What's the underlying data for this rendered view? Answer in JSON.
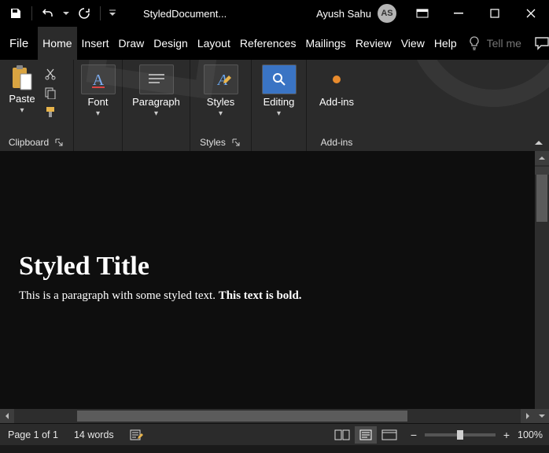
{
  "titlebar": {
    "doc_title": "StyledDocument...",
    "user_name": "Ayush Sahu",
    "user_initials": "AS"
  },
  "menubar": {
    "file": "File",
    "tabs": [
      "Home",
      "Insert",
      "Draw",
      "Design",
      "Layout",
      "References",
      "Mailings",
      "Review",
      "View",
      "Help"
    ],
    "tabs_display": [
      "Home",
      "Insert",
      "Draw",
      "Design",
      "Layout",
      "References",
      "Mailings",
      "Review",
      "View",
      "Help"
    ],
    "tellme_placeholder": "Tell me"
  },
  "ribbon": {
    "clipboard": {
      "paste": "Paste",
      "group": "Clipboard"
    },
    "font": {
      "label": "Font"
    },
    "paragraph": {
      "label": "Paragraph"
    },
    "styles": {
      "label": "Styles",
      "group": "Styles"
    },
    "editing": {
      "label": "Editing"
    },
    "addins": {
      "label": "Add-ins",
      "group": "Add-ins"
    }
  },
  "document": {
    "title": "Styled Title",
    "para_plain": "This is a paragraph with some styled text. ",
    "para_bold": "This text is bold."
  },
  "statusbar": {
    "page": "Page 1 of 1",
    "words": "14 words",
    "zoom": "100%"
  }
}
